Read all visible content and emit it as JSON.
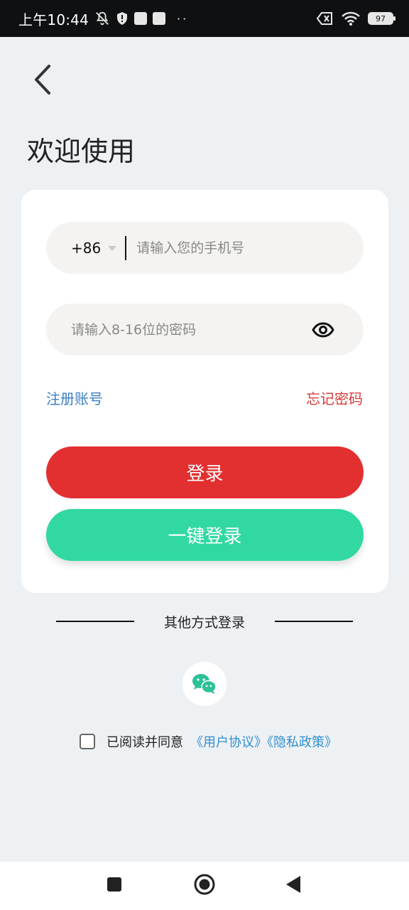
{
  "status_bar": {
    "time": "上午10:44",
    "battery": "97"
  },
  "header": {
    "title": "欢迎使用"
  },
  "form": {
    "country_code": "+86",
    "phone_placeholder": "请输入您的手机号",
    "password_placeholder": "请输入8-16位的密码",
    "register_label": "注册账号",
    "forgot_label": "忘记密码",
    "login_label": "登录",
    "quick_login_label": "一键登录"
  },
  "other": {
    "label": "其他方式登录",
    "options": [
      {
        "icon": "wechat-icon"
      }
    ]
  },
  "agreement": {
    "text": "已阅读并同意",
    "links": "《用户协议》《隐私政策》",
    "checked": false
  },
  "colors": {
    "login": "#e22f30",
    "quick_login": "#31d8a2",
    "register_link": "#3a7fc1",
    "forgot_link": "#d83a3a",
    "agreement_link": "#2f8fd0",
    "wechat": "#2cc197"
  },
  "icons": {
    "back": "chevron-left-icon",
    "eye": "eye-icon",
    "nav": [
      "square-icon",
      "home-circle-icon",
      "back-triangle-icon"
    ]
  }
}
